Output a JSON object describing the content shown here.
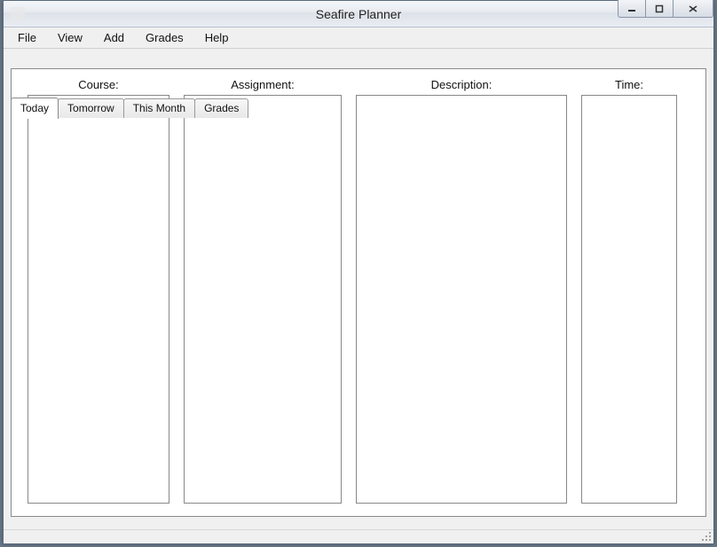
{
  "window": {
    "title": "Seafire Planner"
  },
  "menu": {
    "items": [
      "File",
      "View",
      "Add",
      "Grades",
      "Help"
    ]
  },
  "tabs": {
    "items": [
      "Today",
      "Tomorrow",
      "This Month",
      "Grades"
    ],
    "active_index": 0
  },
  "columns": {
    "course": {
      "label": "Course:"
    },
    "assignment": {
      "label": "Assignment:"
    },
    "description": {
      "label": "Description:"
    },
    "time": {
      "label": "Time:"
    }
  }
}
